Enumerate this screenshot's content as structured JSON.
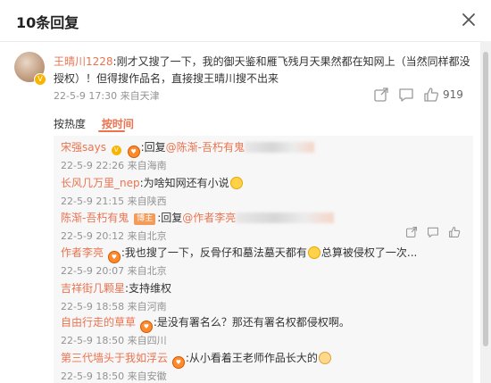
{
  "dialog": {
    "title": "10条回复"
  },
  "main_comment": {
    "username": "王晴川1228",
    "text": ":刚才又搜了一下，我的御天鉴和雁飞残月天果然都在知网上（当然同样都没授权）！但得搜作品名，直接搜王晴川搜不出来",
    "meta": "22-5-9 17:30 来自天津",
    "likes": "919"
  },
  "sort": {
    "hot": "按热度",
    "time": "按时间",
    "active": "按时间"
  },
  "replies": [
    {
      "user": "宋强says",
      "text": ":回复",
      "mention": "@陈渐-吾朽有鬼",
      "meta": "22-5-9 22:26 来自海南"
    },
    {
      "user": "长风几万里_nep",
      "text": ":为啥知网还有小说",
      "meta": "22-5-9 21:15 来自陕西"
    },
    {
      "user": "陈渐-吾朽有鬼",
      "tag": "博主",
      "text": ":回复",
      "mention": "@作者李亮",
      "meta": "22-5-9 20:12 来自北京"
    },
    {
      "user": "作者李亮",
      "text": ":我也搜了一下，反骨仔和墓法墓天都有",
      "text2": "总算被侵权了一次...",
      "meta": "22-5-9 20:07 来自北京"
    },
    {
      "user": "吉祥街几颗星",
      "text": ":支持维权",
      "meta": "22-5-9 18:58 来自河南"
    },
    {
      "user": "自由行走的草草",
      "text": ":是没有署名么？那还有署名权都侵权啊。",
      "meta": "22-5-9 18:50 来自四川"
    },
    {
      "user": "第三代墙头于我如浮云",
      "text": ":从小看着王老师作品长大的",
      "meta": "22-5-9 18:50 来自安徽"
    }
  ],
  "icons": {
    "close": "close-icon",
    "share": "share-icon",
    "comment": "comment-icon",
    "like": "thumbs-up-icon",
    "verified": "verified-badge-icon",
    "fan": "fan-badge-icon",
    "laugh": "laugh-emoji-icon",
    "dog": "dog-emoji-icon"
  },
  "colors": {
    "username": "#eb7350",
    "meta": "#939393",
    "verified": "#f7b500",
    "reply_bg": "#f7f7f7"
  }
}
